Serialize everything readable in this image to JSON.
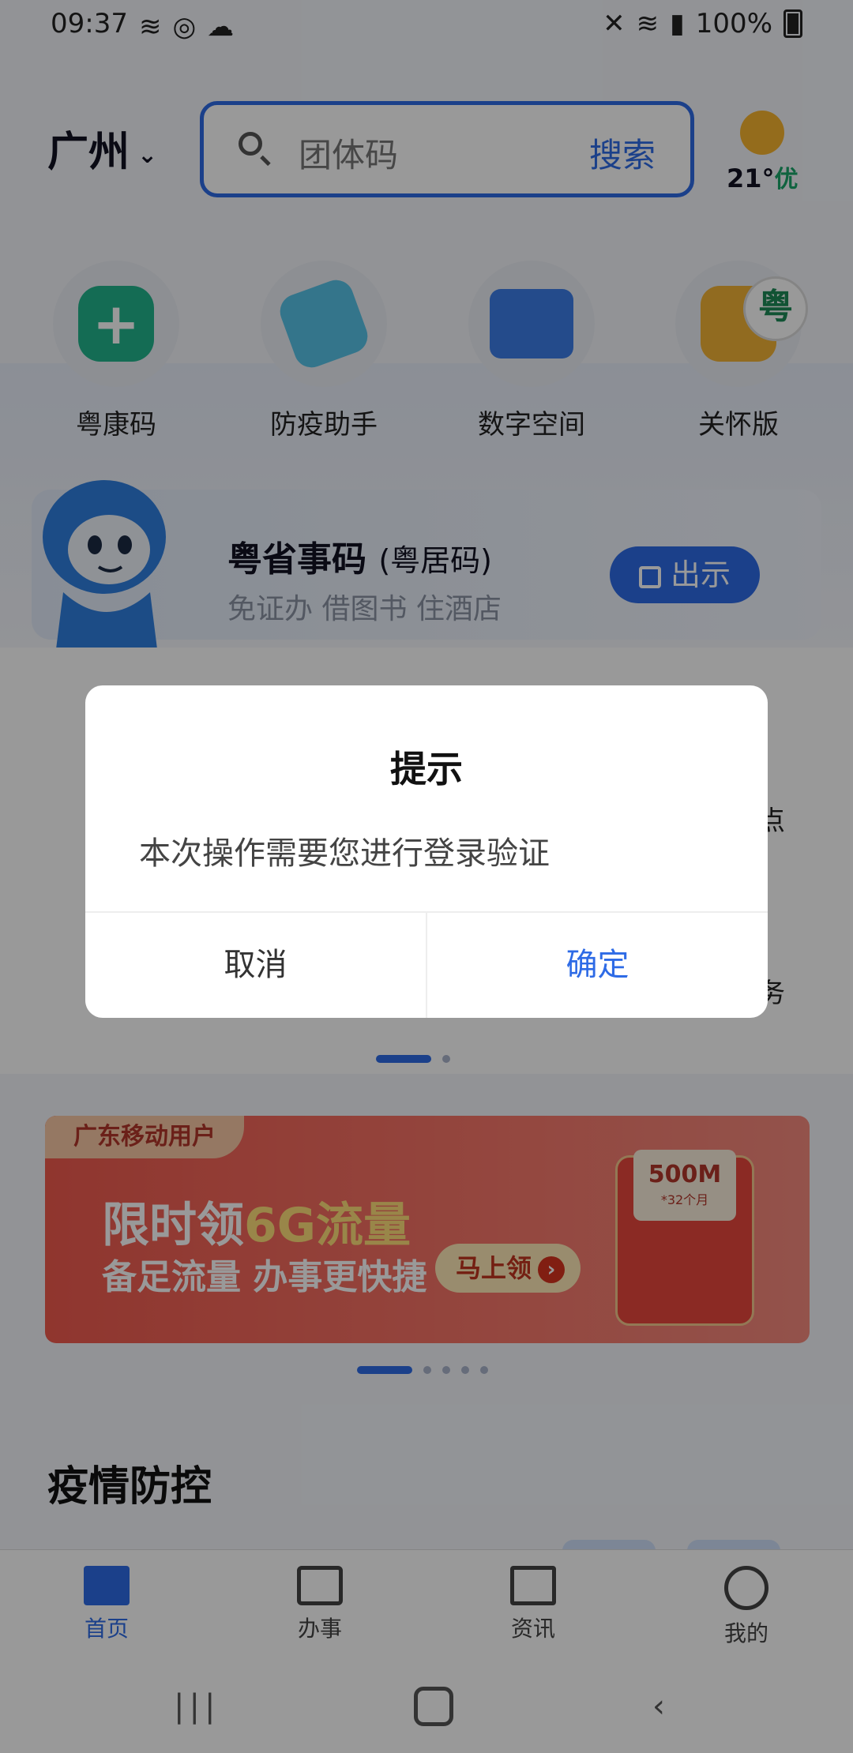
{
  "status_bar": {
    "time": "09:37",
    "battery": "100%"
  },
  "header": {
    "city": "广州",
    "search_placeholder": "团体码",
    "search_action": "搜索",
    "weather": {
      "temp": "21°",
      "air": "优"
    }
  },
  "services": [
    {
      "label": "粤康码",
      "icon": "health-code-icon"
    },
    {
      "label": "防疫助手",
      "icon": "epidemic-assistant-icon"
    },
    {
      "label": "数字空间",
      "icon": "digital-space-icon"
    },
    {
      "label": "关怀版",
      "icon": "care-version-icon",
      "badge": "粤"
    }
  ],
  "code_card": {
    "title": "粤省事码",
    "subtitle_paren": "(粤居码)",
    "desc": "免证办 借图书 住酒店",
    "button": "出示"
  },
  "partial_text": {
    "right_1": "点",
    "right_2": "务"
  },
  "banner": {
    "tag": "广东移动用户",
    "title_prefix": "限时领",
    "title_highlight": "6G流量",
    "subtitle": "备足流量 办事更快捷",
    "cta": "马上领",
    "gift_value": "500M",
    "gift_small": "*32个月"
  },
  "section_title": "疫情防控",
  "tabbar": [
    {
      "label": "首页",
      "icon": "home-icon",
      "active": true
    },
    {
      "label": "办事",
      "icon": "calendar-icon",
      "active": false
    },
    {
      "label": "资讯",
      "icon": "news-icon",
      "active": false
    },
    {
      "label": "我的",
      "icon": "profile-icon",
      "active": false
    }
  ],
  "dialog": {
    "title": "提示",
    "message": "本次操作需要您进行登录验证",
    "cancel": "取消",
    "confirm": "确定"
  },
  "colors": {
    "accent": "#2e6be6",
    "scrim": "rgba(0,0,0,0.4)"
  }
}
